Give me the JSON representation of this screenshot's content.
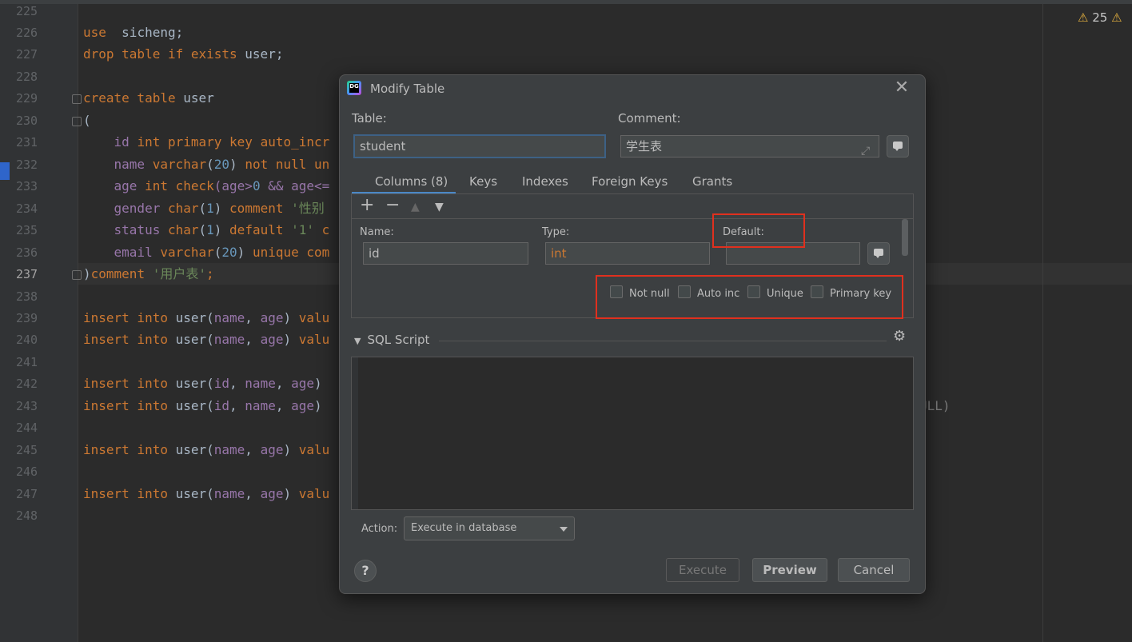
{
  "editor": {
    "line_numbers": [
      "225",
      "226",
      "227",
      "228",
      "229",
      "230",
      "231",
      "232",
      "233",
      "234",
      "235",
      "236",
      "237",
      "238",
      "239",
      "240",
      "241",
      "242",
      "243",
      "244",
      "245",
      "246",
      "247",
      "248"
    ],
    "active_line": "237",
    "warnings_count": "25",
    "lines": {
      "l226": [
        "use",
        "  sicheng;"
      ],
      "l227": [
        "drop table if exists",
        " user;"
      ],
      "l229": [
        "create table",
        " user"
      ],
      "l230": "(",
      "l231": [
        "    id ",
        "int primary key auto_incr"
      ],
      "l232": [
        "    name ",
        "varchar",
        "(",
        "20",
        ") ",
        "not null un"
      ],
      "l233": [
        "    age ",
        "int check",
        "(age>",
        "0",
        " && age<="
      ],
      "l234": [
        "    gender ",
        "char",
        "(",
        "1",
        ") ",
        "comment ",
        "'性别"
      ],
      "l235": [
        "    status ",
        "char",
        "(",
        "1",
        ") ",
        "default ",
        "'1'",
        " c"
      ],
      "l236": [
        "    email ",
        "varchar",
        "(",
        "20",
        ") ",
        "unique com"
      ],
      "l237": [
        ")",
        "comment ",
        "'用户表'",
        ";"
      ],
      "l239": [
        "insert into",
        " user(",
        "name",
        ", ",
        "age",
        ") ",
        "valu"
      ],
      "l240": [
        "insert into",
        " user(",
        "name",
        ", ",
        "age",
        ") ",
        "valu"
      ],
      "l242": [
        "insert into",
        " user(",
        "id",
        ", ",
        "name",
        ", ",
        "age",
        ")"
      ],
      "l243": [
        "insert into",
        " user(",
        "id",
        ", ",
        "name",
        ", ",
        "age",
        ")"
      ],
      "l245": [
        "insert into",
        " user(",
        "name",
        ", ",
        "age",
        ") ",
        "valu"
      ],
      "l247": [
        "insert into",
        " user(",
        "name",
        ", ",
        "age",
        ") ",
        "valu"
      ]
    },
    "tail_text": "ULL)"
  },
  "dialog": {
    "title": "Modify Table",
    "logo_text": "DG",
    "table_label": "Table:",
    "table_value": "student",
    "comment_label": "Comment:",
    "comment_value": "学生表",
    "tabs": [
      "Columns (8)",
      "Keys",
      "Indexes",
      "Foreign Keys",
      "Grants"
    ],
    "toolbar": {
      "add": "+",
      "remove": "−",
      "up": "▲",
      "down": "▼"
    },
    "column": {
      "name_label": "Name:",
      "name_value": "id",
      "type_label": "Type:",
      "type_value": "int",
      "default_label": "Default:",
      "default_value": ""
    },
    "checkboxes": [
      "Not null",
      "Auto inc",
      "Unique",
      "Primary key"
    ],
    "sql_section": "SQL Script",
    "action_label": "Action:",
    "action_value": "Execute in database",
    "buttons": {
      "execute": "Execute",
      "preview": "Preview",
      "cancel": "Cancel",
      "help": "?"
    }
  },
  "colors": {
    "highlight": "#e0301e",
    "accent": "#4a88c7",
    "type_text": "#cc7832"
  }
}
